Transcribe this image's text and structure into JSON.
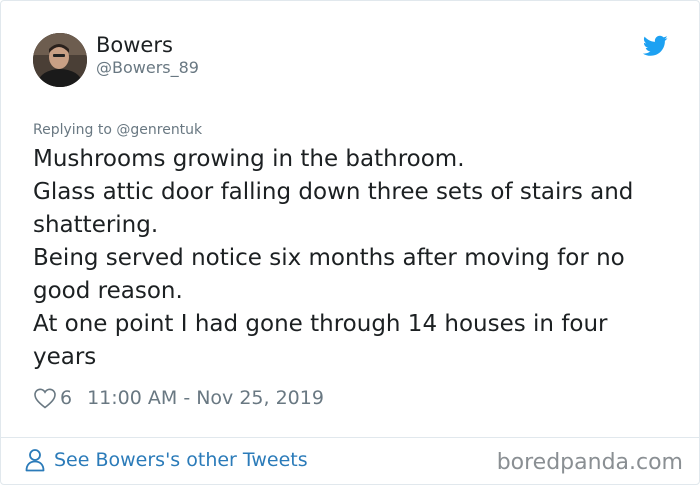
{
  "author": {
    "name": "Bowers",
    "handle": "@Bowers_89"
  },
  "reply_to": "Replying to @genrentuk",
  "tweet": {
    "lines": [
      "Mushrooms growing in the bathroom.",
      "Glass attic door falling down three sets of stairs and shattering.",
      "Being served notice six months after moving for no good reason.",
      "At one point I had gone through 14 houses in four years"
    ]
  },
  "meta": {
    "likes": "6",
    "timestamp": "11:00 AM - Nov 25, 2019"
  },
  "footer": {
    "see_more": "See Bowers's other Tweets",
    "watermark": "boredpanda.com"
  },
  "icons": {
    "brand": "twitter-bird-icon",
    "like": "heart-icon",
    "profile": "person-icon"
  },
  "colors": {
    "twitter_blue": "#1da1f2",
    "link_blue": "#2b7bb9",
    "text": "#1c2022",
    "muted": "#697882",
    "border": "#e1e8ed"
  }
}
